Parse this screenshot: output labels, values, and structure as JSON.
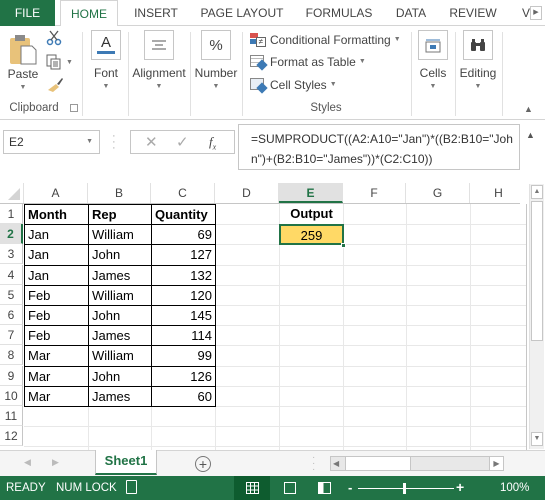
{
  "tabs": [
    {
      "label": "FILE"
    },
    {
      "label": "HOME",
      "active": true
    },
    {
      "label": "INSERT"
    },
    {
      "label": "PAGE LAYOUT"
    },
    {
      "label": "FORMULAS"
    },
    {
      "label": "DATA"
    },
    {
      "label": "REVIEW"
    }
  ],
  "ribbon": {
    "clipboard": {
      "paste": "Paste",
      "group": "Clipboard"
    },
    "font": "Font",
    "alignment": "Alignment",
    "number": "Number",
    "styles": {
      "conditional": "Conditional Formatting",
      "format_table": "Format as Table",
      "cell_styles": "Cell Styles",
      "group": "Styles"
    },
    "cells": "Cells",
    "editing": "Editing"
  },
  "formula_bar": {
    "name_box": "E2",
    "fx": "fx",
    "formula": "=SUMPRODUCT((A2:A10=\"Jan\")*((B2:B10=\"John\")+(B2:B10=\"James\"))*(C2:C10))"
  },
  "columns": [
    "A",
    "B",
    "C",
    "D",
    "E",
    "F",
    "G",
    "H"
  ],
  "rows": [
    "1",
    "2",
    "3",
    "4",
    "5",
    "6",
    "7",
    "8",
    "9",
    "10",
    "11",
    "12"
  ],
  "table": {
    "headers": [
      "Month",
      "Rep",
      "Quantity"
    ],
    "rows": [
      [
        "Jan",
        "William",
        "69"
      ],
      [
        "Jan",
        "John",
        "127"
      ],
      [
        "Jan",
        "James",
        "132"
      ],
      [
        "Feb",
        "William",
        "120"
      ],
      [
        "Feb",
        "John",
        "145"
      ],
      [
        "Feb",
        "James",
        "114"
      ],
      [
        "Mar",
        "William",
        "99"
      ],
      [
        "Mar",
        "John",
        "126"
      ],
      [
        "Mar",
        "James",
        "60"
      ]
    ]
  },
  "output": {
    "label": "Output",
    "value": "259",
    "fill": "#ffd966"
  },
  "sheet": {
    "name": "Sheet1"
  },
  "status": {
    "ready": "READY",
    "numlock": "NUM LOCK",
    "zoom": "100%"
  },
  "colors": {
    "accent": "#217346"
  }
}
